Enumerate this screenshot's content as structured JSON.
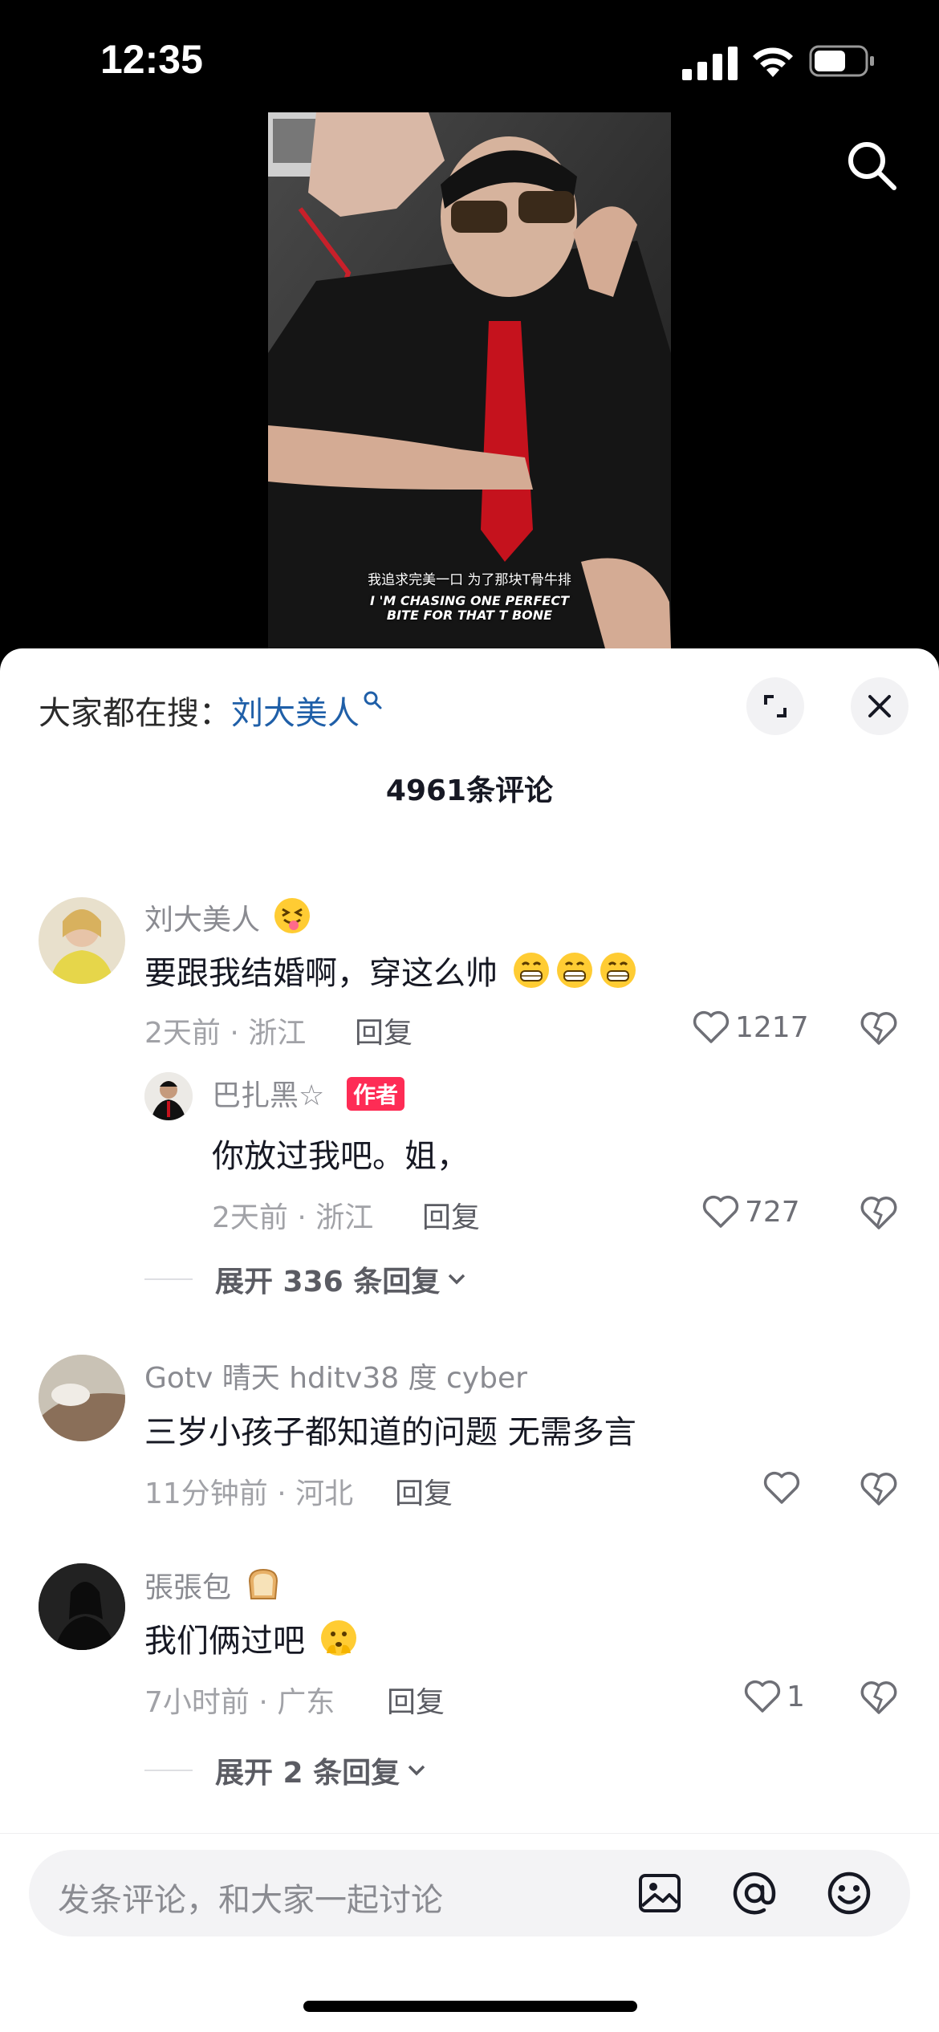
{
  "status": {
    "time": "12:35"
  },
  "video": {
    "subtitle_cn": "我追求完美一口 为了那块T骨牛排",
    "subtitle_en": "I 'M CHASING ONE PERFECT BITE FOR THAT T BONE"
  },
  "sheet": {
    "trending_prefix": "大家都在搜：",
    "trending_keyword": "刘大美人",
    "comment_count": "4961条评论"
  },
  "comments": [
    {
      "user": "刘大美人",
      "text": "要跟我结婚啊，穿这么帅",
      "meta": "2天前 · 浙江",
      "reply": "回复",
      "likes": "1217",
      "replies": [
        {
          "user": "巴扎黑☆",
          "badge": "作者",
          "text": "你放过我吧。姐，",
          "meta": "2天前 · 浙江",
          "reply": "回复",
          "likes": "727"
        }
      ],
      "expand": "展开 336 条回复"
    },
    {
      "user": "Gotv 晴天 hditv38 度 cyber",
      "text": "三岁小孩子都知道的问题 无需多言",
      "meta": "11分钟前 · 河北",
      "reply": "回复",
      "likes": ""
    },
    {
      "user": "張張包",
      "text": "我们俩过吧",
      "meta": "7小时前 · 广东",
      "reply": "回复",
      "likes": "1",
      "expand": "展开 2 条回复"
    }
  ],
  "input": {
    "placeholder": "发条评论，和大家一起讨论"
  },
  "colors": {
    "accent": "#fe2c55",
    "link": "#1f5fa8"
  }
}
